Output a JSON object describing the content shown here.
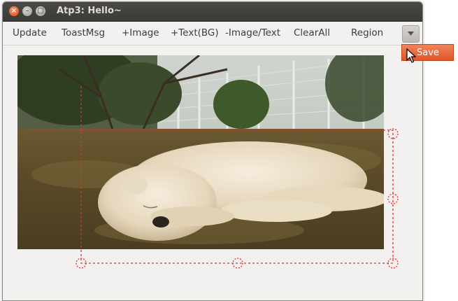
{
  "window": {
    "title": "Atp3: Hello~",
    "controls": {
      "close": "×",
      "minimize": "–",
      "maximize": "□"
    }
  },
  "toolbar": {
    "buttons": [
      {
        "id": "update",
        "label": "Update"
      },
      {
        "id": "toastmsg",
        "label": "ToastMsg"
      },
      {
        "id": "add-image",
        "label": "+Image"
      },
      {
        "id": "add-text-bg",
        "label": "+Text(BG)"
      },
      {
        "id": "remove-image-text",
        "label": "-Image/Text"
      },
      {
        "id": "clearall",
        "label": "ClearAll"
      },
      {
        "id": "region",
        "label": "Region"
      }
    ],
    "overflow_icon": "chevron-down-icon"
  },
  "popup_menu": {
    "items": [
      {
        "label": "Save"
      }
    ]
  },
  "canvas": {
    "image_subject": "white dog sleeping on grass",
    "selection_color": "#e03030"
  },
  "colors": {
    "accent": "#e0562a",
    "titlebar": "#3c3b37",
    "window_bg": "#f2f1f0"
  }
}
